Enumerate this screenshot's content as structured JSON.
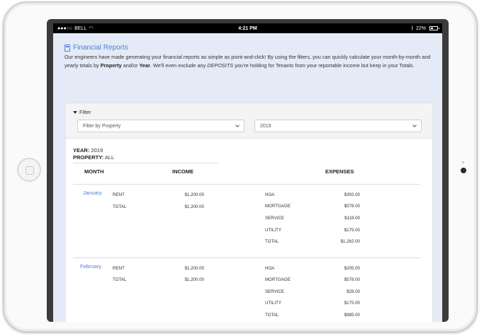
{
  "status_bar": {
    "carrier": "BELL",
    "time": "4:21 PM",
    "battery": "22%"
  },
  "page": {
    "title": "Financial Reports",
    "intro_part1": "Our engineers have made generating your financial reports as simple as point-and-click! By using the filters, you can quickly calculate your month-by-month and yearly totals by ",
    "intro_bold1": "Property",
    "intro_part2": " and/or ",
    "intro_bold2": "Year",
    "intro_part3": ". We'll even exclude any ",
    "intro_italic": "DEPOSITS",
    "intro_part4": " you're holding for Tenants from your reportable income but keep in your Totals."
  },
  "filter": {
    "label": "Filter",
    "property_placeholder": "Filter by Property",
    "year_value": "2019"
  },
  "summary": {
    "year_label": "YEAR:",
    "year_value": "2019",
    "property_label": "PROPERTY:",
    "property_value": "ALL"
  },
  "table": {
    "headers": {
      "month": "MONTH",
      "income": "INCOME",
      "expenses": "EXPENSES"
    },
    "months": [
      {
        "name": "January",
        "income": [
          {
            "label": "RENT",
            "amount": "$1,200.00"
          },
          {
            "label": "TOTAL",
            "amount": "$1,200.00"
          }
        ],
        "expenses": [
          {
            "label": "HOA",
            "amount": "$392.00"
          },
          {
            "label": "MORTGAGE",
            "amount": "$578.00"
          },
          {
            "label": "SERVICE",
            "amount": "$118.00"
          },
          {
            "label": "UTILITY",
            "amount": "$175.00"
          },
          {
            "label": "TOTAL",
            "amount": "$1,262.00"
          }
        ]
      },
      {
        "name": "February",
        "income": [
          {
            "label": "RENT",
            "amount": "$1,200.00"
          },
          {
            "label": "TOTAL",
            "amount": "$1,200.00"
          }
        ],
        "expenses": [
          {
            "label": "HOA",
            "amount": "$205.00"
          },
          {
            "label": "MORTGAGE",
            "amount": "$578.00"
          },
          {
            "label": "SERVICE",
            "amount": "$28.00"
          },
          {
            "label": "UTILITY",
            "amount": "$175.00"
          },
          {
            "label": "TOTAL",
            "amount": "$985.00"
          }
        ]
      }
    ]
  },
  "colors": {
    "accent": "#4a7fd6",
    "page_bg": "#e4ebf6"
  }
}
